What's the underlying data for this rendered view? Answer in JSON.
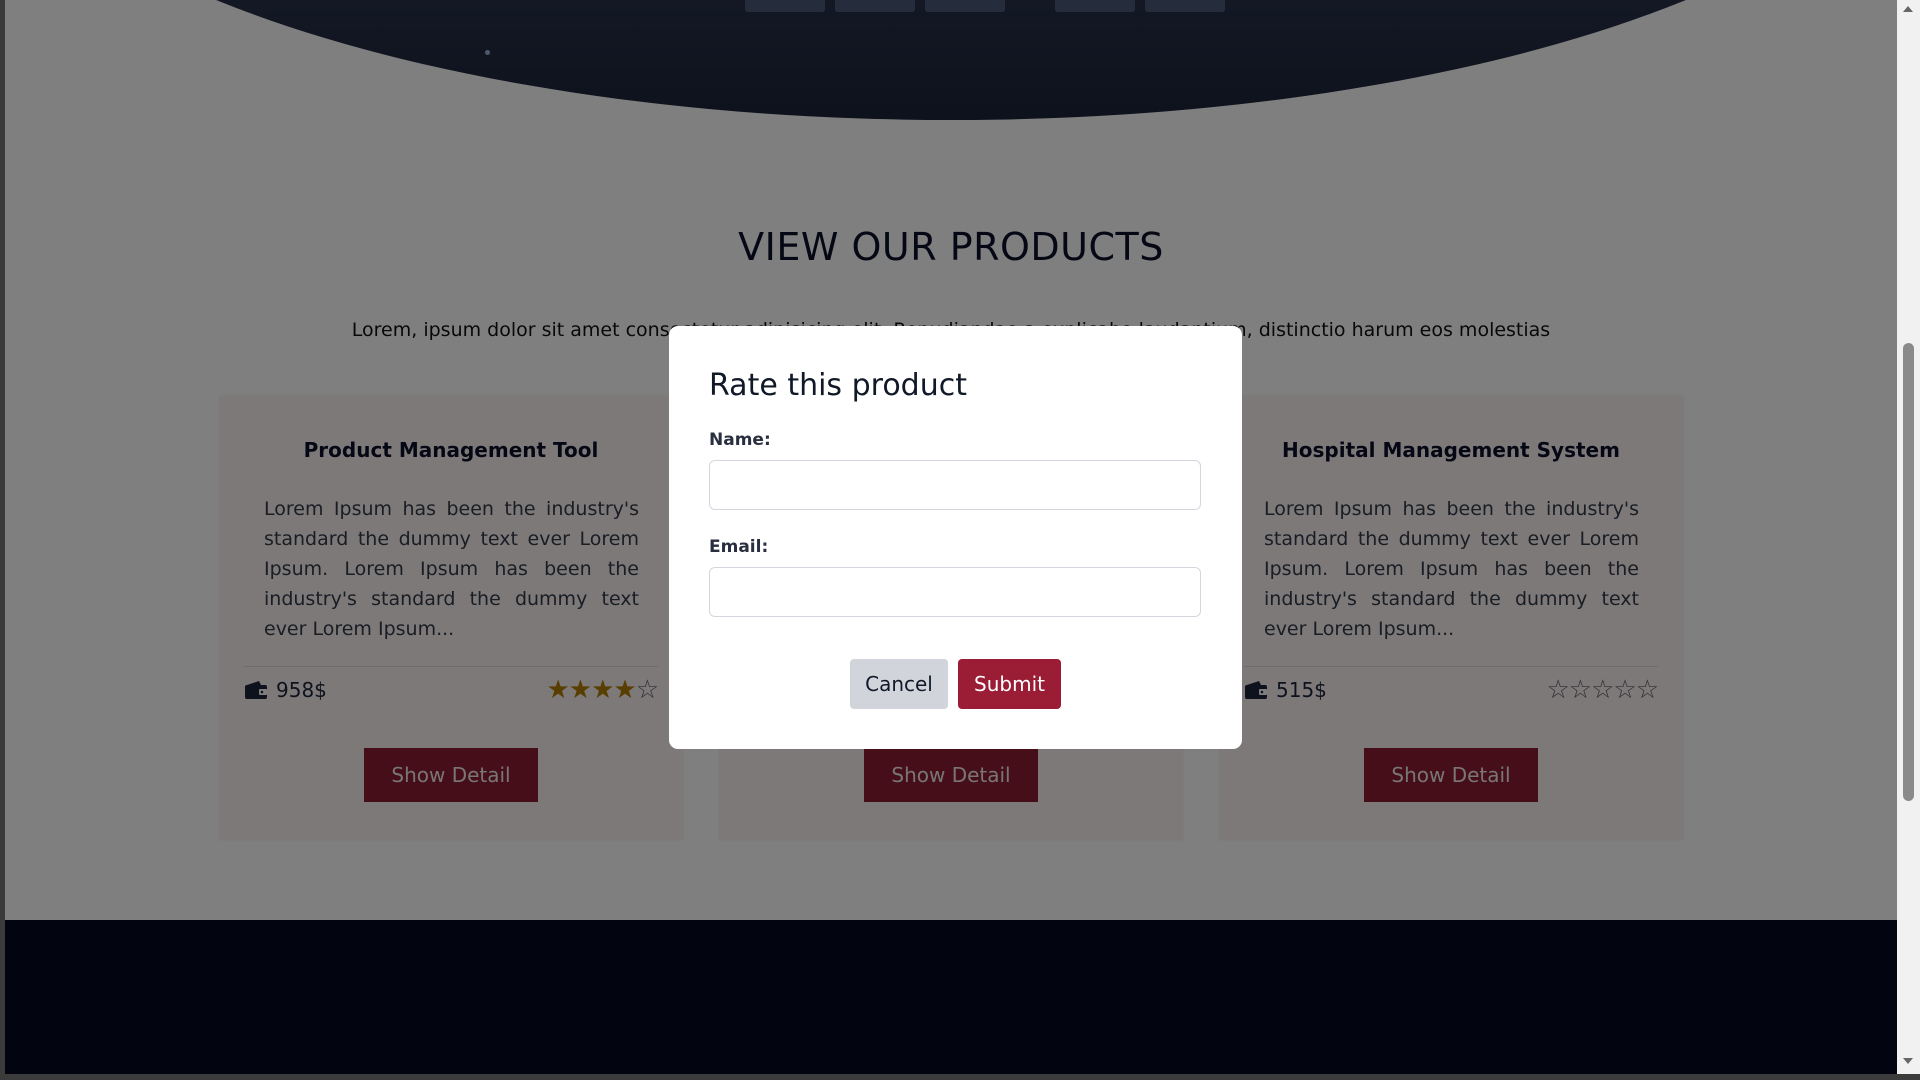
{
  "section": {
    "title": "VIEW OUR PRODUCTS",
    "subtitle": "Lorem, ipsum dolor sit amet consectetur adipisicing elit. Repudiandae a explicabo laudantium, distinctio harum eos molestias"
  },
  "products": [
    {
      "title": "Product Management Tool",
      "description": "Lorem Ipsum has been the industry's standard the dummy text ever Lorem Ipsum. Lorem Ipsum has been the industry's standard the dummy text ever Lorem Ipsum...",
      "price": "958$",
      "rating": 4,
      "max_rating": 5,
      "button_label": "Show Detail",
      "price_icon": "wallet-icon"
    },
    {
      "title": "",
      "description": "",
      "price": "",
      "rating": null,
      "max_rating": 5,
      "button_label": "Show Detail",
      "price_icon": "wallet-icon"
    },
    {
      "title": "Hospital Management System",
      "description": "Lorem Ipsum has been the industry's standard the dummy text ever Lorem Ipsum. Lorem Ipsum has been the industry's standard the dummy text ever Lorem Ipsum...",
      "price": "515$",
      "rating": 0,
      "max_rating": 5,
      "button_label": "Show Detail",
      "price_icon": "wallet-icon"
    }
  ],
  "modal": {
    "title": "Rate this product",
    "name_label": "Name:",
    "name_value": "",
    "email_label": "Email:",
    "email_value": "",
    "cancel_label": "Cancel",
    "submit_label": "Submit"
  },
  "colors": {
    "accent": "#8a1c31",
    "submit": "#9b1c35",
    "footer": "#050a1e",
    "star": "#b07d00"
  }
}
